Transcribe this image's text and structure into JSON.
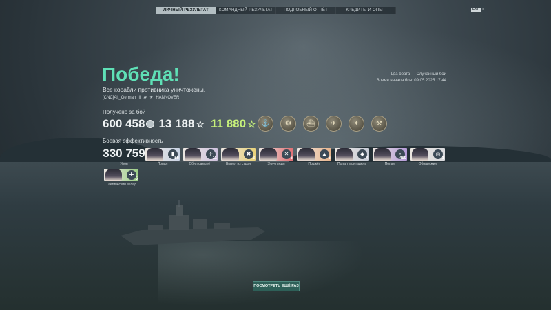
{
  "tabs": [
    {
      "label": "ЛИЧНЫЙ РЕЗУЛЬТАТ",
      "active": true
    },
    {
      "label": "КОМАНДНЫЙ РЕЗУЛЬТАТ",
      "active": false
    },
    {
      "label": "ПОДРОБНЫЙ ОТЧЁТ",
      "active": false
    },
    {
      "label": "КРЕДИТЫ И ОПЫТ",
      "active": false
    }
  ],
  "lang": {
    "badge": "ESC",
    "suffix": "≡"
  },
  "result": {
    "title": "Победа!",
    "subtitle": "Все корабли противника уничтожены.",
    "player": "[CNC]Alt_German",
    "ship": "HANNOVER",
    "mode": "Два брата — Случайный бой",
    "start_time": "Время начала боя: 09.05.2025 17:44"
  },
  "earned": {
    "label": "Получено за бой",
    "credits": "600 458",
    "xp": "13 188",
    "free_xp": "11 880"
  },
  "medals": [
    "anchor-medal-icon",
    "wreath-medal-icon",
    "warship-medal-icon",
    "bomber-medal-icon",
    "compass-medal-icon",
    "crossed-tools-medal-icon"
  ],
  "efficiency": {
    "label": "Боевая эффективность",
    "damage_value": "330 759",
    "damage_label": "Урон",
    "cards": [
      {
        "label": "Попал",
        "count": "56",
        "symbol": "▮"
      },
      {
        "label": "Сбил самолёт",
        "count": "11",
        "symbol": "✈"
      },
      {
        "label": "Вывел из строя",
        "count": "2",
        "symbol": "✖"
      },
      {
        "label": "Уничтожил",
        "count": "6",
        "symbol": "✕"
      },
      {
        "label": "Поджёг",
        "count": "6",
        "symbol": "▲"
      },
      {
        "label": "Попал в цитадель",
        "count": "4",
        "symbol": "◆"
      },
      {
        "label": "Попал",
        "count": "480",
        "symbol": "•"
      },
      {
        "label": "Обнаружил",
        "count": "1",
        "symbol": "◎"
      },
      {
        "label": "Тактический вклад",
        "count": "5",
        "symbol": "✚"
      }
    ]
  },
  "replay_button": "ПОСМОТРЕТЬ ЕЩЁ РАЗ"
}
